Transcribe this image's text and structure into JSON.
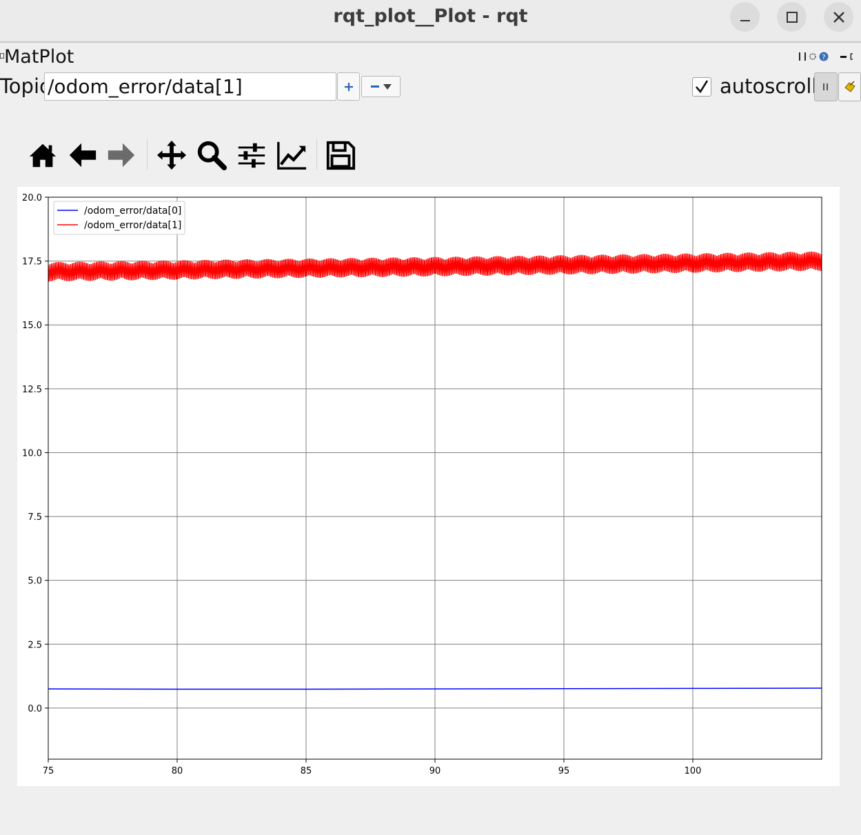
{
  "window": {
    "title": "rqt_plot__Plot - rqt"
  },
  "plugin": {
    "title": "MatPlot"
  },
  "topic_bar": {
    "label": "Topic",
    "input_value": "/odom_error/data[1]",
    "autoscroll_label": "autoscroll",
    "autoscroll_checked": true
  },
  "toolbar": {
    "items": [
      "home-icon",
      "back-icon",
      "forward-icon",
      "pan-icon",
      "zoom-icon",
      "configure-subplots-icon",
      "edit-axis-icon",
      "save-icon"
    ]
  },
  "chart_data": {
    "type": "line",
    "title": "",
    "xlabel": "",
    "ylabel": "",
    "xlim": [
      75,
      105
    ],
    "ylim": [
      -2,
      20
    ],
    "xticks": [
      75,
      80,
      85,
      90,
      95,
      100
    ],
    "yticks": [
      0.0,
      2.5,
      5.0,
      7.5,
      10.0,
      12.5,
      15.0,
      17.5,
      20.0
    ],
    "ytick_labels": [
      "0.0",
      "2.5",
      "5.0",
      "7.5",
      "10.0",
      "12.5",
      "15.0",
      "17.5",
      "20.0"
    ],
    "grid": true,
    "legend_position": "top-left",
    "series": [
      {
        "name": "/odom_error/data[0]",
        "color": "#0000ff",
        "x": [
          75,
          80,
          85,
          90,
          95,
          100,
          105
        ],
        "y": [
          0.75,
          0.74,
          0.74,
          0.75,
          0.76,
          0.77,
          0.78
        ]
      },
      {
        "name": "/odom_error/data[1]",
        "color": "#ff0000",
        "noise_band": 0.38,
        "x": [
          75,
          80,
          85,
          90,
          95,
          100,
          105
        ],
        "y": [
          17.08,
          17.15,
          17.22,
          17.28,
          17.35,
          17.42,
          17.5
        ]
      }
    ]
  }
}
